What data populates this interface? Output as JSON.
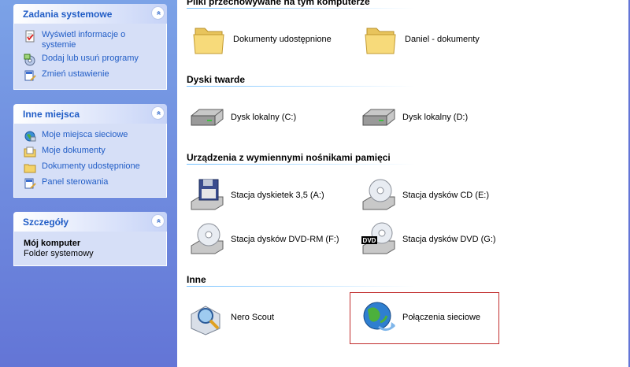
{
  "system_tasks": {
    "title": "Zadania systemowe",
    "collapse_glyph": "«",
    "items": [
      {
        "label": "Wyświetl informacje o systemie",
        "icon": "system-info-icon"
      },
      {
        "label": "Dodaj lub usuń programy",
        "icon": "add-remove-programs-icon"
      },
      {
        "label": "Zmień ustawienie",
        "icon": "change-setting-icon"
      }
    ]
  },
  "other_places": {
    "title": "Inne miejsca",
    "collapse_glyph": "«",
    "items": [
      {
        "label": "Moje miejsca sieciowe",
        "icon": "network-places-icon"
      },
      {
        "label": "Moje dokumenty",
        "icon": "my-documents-icon"
      },
      {
        "label": "Dokumenty udostępnione",
        "icon": "shared-folder-icon"
      },
      {
        "label": "Panel sterowania",
        "icon": "control-panel-icon"
      }
    ]
  },
  "details": {
    "title": "Szczegóły",
    "collapse_glyph": "«",
    "name": "Mój komputer",
    "type": "Folder systemowy"
  },
  "groups": {
    "files": {
      "title": "Pliki przechowywane na tym komputerze",
      "items": [
        {
          "label": "Dokumenty udostępnione",
          "icon": "folder-icon"
        },
        {
          "label": "Daniel - dokumenty",
          "icon": "folder-icon"
        }
      ]
    },
    "hard_disks": {
      "title": "Dyski twarde",
      "items": [
        {
          "label": "Dysk lokalny (C:)",
          "icon": "hard-disk-icon"
        },
        {
          "label": "Dysk lokalny (D:)",
          "icon": "hard-disk-icon"
        }
      ]
    },
    "removable": {
      "title": "Urządzenia z wymiennymi nośnikami pamięci",
      "items": [
        {
          "label": "Stacja dyskietek 3,5 (A:)",
          "icon": "floppy-drive-icon"
        },
        {
          "label": "Stacja dysków CD (E:)",
          "icon": "cd-drive-icon"
        },
        {
          "label": "Stacja dysków DVD-RM (F:)",
          "icon": "cd-drive-icon"
        },
        {
          "label": "Stacja dysków DVD (G:)",
          "icon": "dvd-drive-icon",
          "badge": "DVD"
        }
      ]
    },
    "other": {
      "title": "Inne",
      "items": [
        {
          "label": "Nero Scout",
          "icon": "nero-scout-icon"
        },
        {
          "label": "Połączenia sieciowe",
          "icon": "network-connections-icon"
        }
      ]
    }
  },
  "colors": {
    "pane_top": "#7ba2e7",
    "pane_bottom": "#6375d6",
    "link": "#215dc6",
    "selection_border": "#c12d2d"
  }
}
